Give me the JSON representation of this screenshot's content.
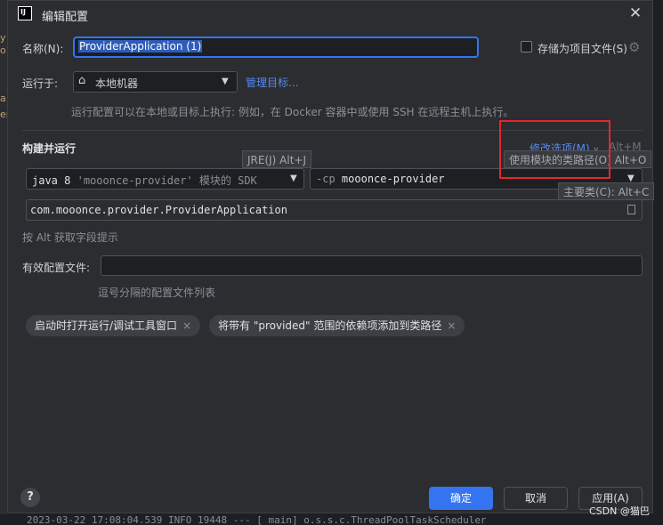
{
  "dialog": {
    "title": "编辑配置",
    "close_glyph": "✕",
    "logo_text": "IJ"
  },
  "name_row": {
    "label": "名称(N):",
    "value": "ProviderApplication (1)",
    "store_label": "存储为项目文件(S)",
    "store_checked": false
  },
  "run_on": {
    "label": "运行于:",
    "target": "本地机器",
    "target_icon": "home-icon",
    "manage_link": "管理目标...",
    "hint": "运行配置可以在本地或目标上执行: 例如，在 Docker 容器中或使用 SSH 在远程主机上执行。"
  },
  "build_run": {
    "section_label": "构建并运行",
    "modify_options": "修改选项(M)",
    "modify_shortcut": "Alt+M",
    "jre_tooltip": "JRE(J)  Alt+J",
    "module_cp_tooltip": "使用模块的类路径(O)  Alt+O",
    "main_class_tooltip": "主要类(C): Alt+C",
    "sdk_value_prefix": "java 8",
    "sdk_value_module": "'mooonce-provider'",
    "sdk_value_suffix": "模块的 SDK",
    "cp_flag": "-cp",
    "cp_value": "mooonce-provider",
    "main_class": "com.mooonce.provider.ProviderApplication",
    "alt_hint": "按 Alt 获取字段提示"
  },
  "env_file": {
    "label": "有效配置文件:",
    "value": "",
    "hint": "逗号分隔的配置文件列表"
  },
  "tags": [
    {
      "label": "启动时打开运行/调试工具窗口"
    },
    {
      "label": "将带有 \"provided\" 范围的依赖项添加到类路径"
    }
  ],
  "tag_remove_glyph": "×",
  "buttons": {
    "ok": "确定",
    "cancel": "取消",
    "apply": "应用(A)",
    "help": "?"
  },
  "background": {
    "bottom_log": "2023-03-22 17:08:04.539  INFO 19448 ---  [          main] o.s.s.c.ThreadPoolTaskScheduler",
    "left_chars": [
      "y",
      "o",
      "a",
      "er"
    ]
  },
  "watermark": "CSDN @猫巴",
  "colors": {
    "accent": "#3574f0",
    "link": "#548af7",
    "highlight_box": "#e8262d",
    "dialog_bg": "#2b2d30"
  }
}
